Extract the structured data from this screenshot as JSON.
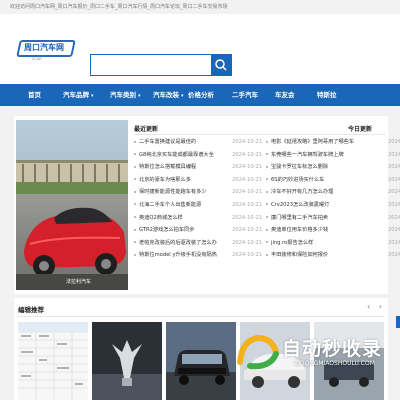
{
  "topbar": {
    "text": "欢迎访问周口汽车网_周口汽车报价_周口二手车_周口汽车行情_周口汽车论坛_周口二手车交易市场"
  },
  "logo": {
    "text": "周口汽车网",
    "sub": "ZCAR"
  },
  "search": {
    "value": "",
    "placeholder": ""
  },
  "nav": {
    "items": [
      {
        "label": "首页",
        "dropdown": false
      },
      {
        "label": "汽车品牌",
        "dropdown": true
      },
      {
        "label": "汽车类别",
        "dropdown": true
      },
      {
        "label": "汽车改装",
        "dropdown": true
      },
      {
        "label": "价格分析",
        "dropdown": false
      },
      {
        "label": "二手汽车",
        "dropdown": false
      },
      {
        "label": "车友会",
        "dropdown": false
      },
      {
        "label": "特斯拉",
        "dropdown": false
      }
    ]
  },
  "latest": {
    "title": "最近更新",
    "today_title": "今日更新",
    "left": [
      {
        "title": "二手车置换建议是最佳的",
        "date": "2024-10-21"
      },
      {
        "title": "G8纯北京买车能成都最靠谱大全",
        "date": "2024-10-21"
      },
      {
        "title": "特斯拉怎么搭载模具编程",
        "date": "2024-10-21"
      },
      {
        "title": "北京的豪车为啥那么多",
        "date": "2024-10-21"
      },
      {
        "title": "保时捷新能源性能跑车有多少",
        "date": "2024-10-21"
      },
      {
        "title": "北海二手车个人出售新能源",
        "date": "2024-10-21"
      },
      {
        "title": "奥迪Q2商城怎么样",
        "date": "2024-10-21"
      },
      {
        "title": "GTR2游戏怎么拍车同步",
        "date": "2024-10-21"
      },
      {
        "title": "老帕克改装后的后驱改装了怎么办",
        "date": "2024-10-21"
      },
      {
        "title": "特斯拉model y升级手机没有隔热",
        "date": "2024-10-21"
      }
    ],
    "right": [
      {
        "title": "电影《延禧攻略》里阿哥用了哪些车",
        "date": "2024-10-21"
      },
      {
        "title": "东莞哪些一汽车辆驾驶车牌上牌",
        "date": "2024-10-21"
      },
      {
        "title": "宝骏卡罗拉车标怎么删除",
        "date": "2024-10-21"
      },
      {
        "title": "6S的巧妙进场买什么车",
        "date": "2024-10-21"
      },
      {
        "title": "冷车不好开有几万怎么办理",
        "date": "2024-10-21"
      },
      {
        "title": "Crv2023怎么改装黑曜灯",
        "date": "2024-10-21"
      },
      {
        "title": "廉门哪里有二手汽车拍卖",
        "date": "2024-10-21"
      },
      {
        "title": "奥迪单位用车价格多少钱",
        "date": "2024-10-21"
      },
      {
        "title": "jing.ro报告怎么样",
        "date": "2024-10-21"
      },
      {
        "title": "丰田装修和保险如何报价",
        "date": "2024-10-21"
      }
    ]
  },
  "hero": {
    "caption": "法拉利汽车"
  },
  "recommend": {
    "title": "编辑推荐",
    "prev": "‹",
    "next": "›"
  },
  "watermark": {
    "big": "自动秒收录",
    "small": "ZIDONGMIAOSHOULU.COM"
  },
  "colors": {
    "brand": "#1a66b8",
    "background": "#f2f2f2"
  }
}
